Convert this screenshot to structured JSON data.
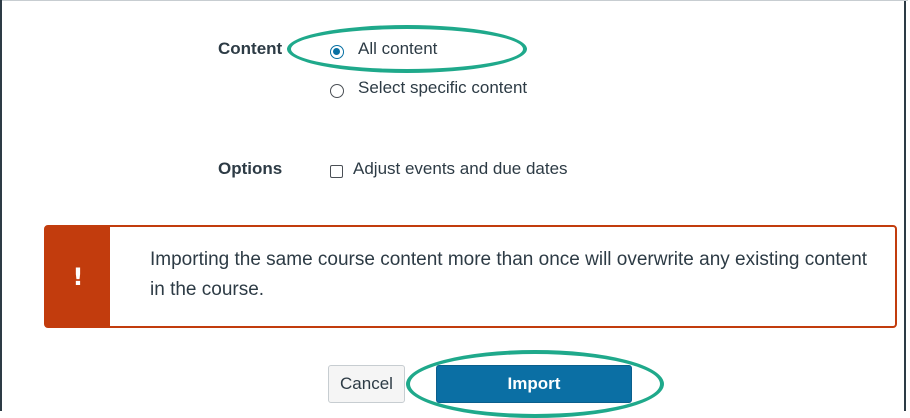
{
  "content_row": {
    "label": "Content",
    "options": [
      {
        "label": "All content",
        "selected": true
      },
      {
        "label": "Select specific content",
        "selected": false
      }
    ]
  },
  "options_row": {
    "label": "Options",
    "checkbox_label": "Adjust events and due dates",
    "checked": false
  },
  "alert": {
    "icon": "!",
    "message": "Importing the same course content more than once will overwrite any existing content in the course."
  },
  "buttons": {
    "cancel_label": "Cancel",
    "import_label": "Import"
  },
  "colors": {
    "alert": "#c23c0d",
    "primary_button": "#0b6fa4",
    "highlight": "#1fa98b",
    "radio_selected": "#0770a3"
  }
}
